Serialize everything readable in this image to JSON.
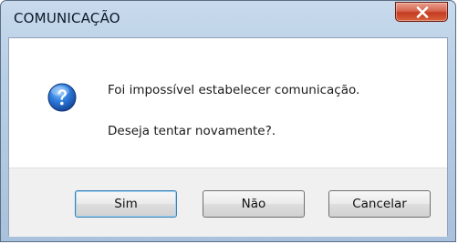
{
  "window": {
    "title": "COMUNICAÇÃO",
    "close_icon": "close-icon"
  },
  "message": {
    "icon": "question-icon",
    "line1": "Foi impossível estabelecer comunicação.",
    "line2": "Deseja tentar novamente?."
  },
  "buttons": {
    "yes_label": "Sim",
    "no_label": "Não",
    "cancel_label": "Cancelar",
    "default": "yes"
  },
  "colors": {
    "titlebar": "#b9cfe6",
    "close_button": "#c43b1f",
    "icon_blue": "#1f5fb8"
  }
}
